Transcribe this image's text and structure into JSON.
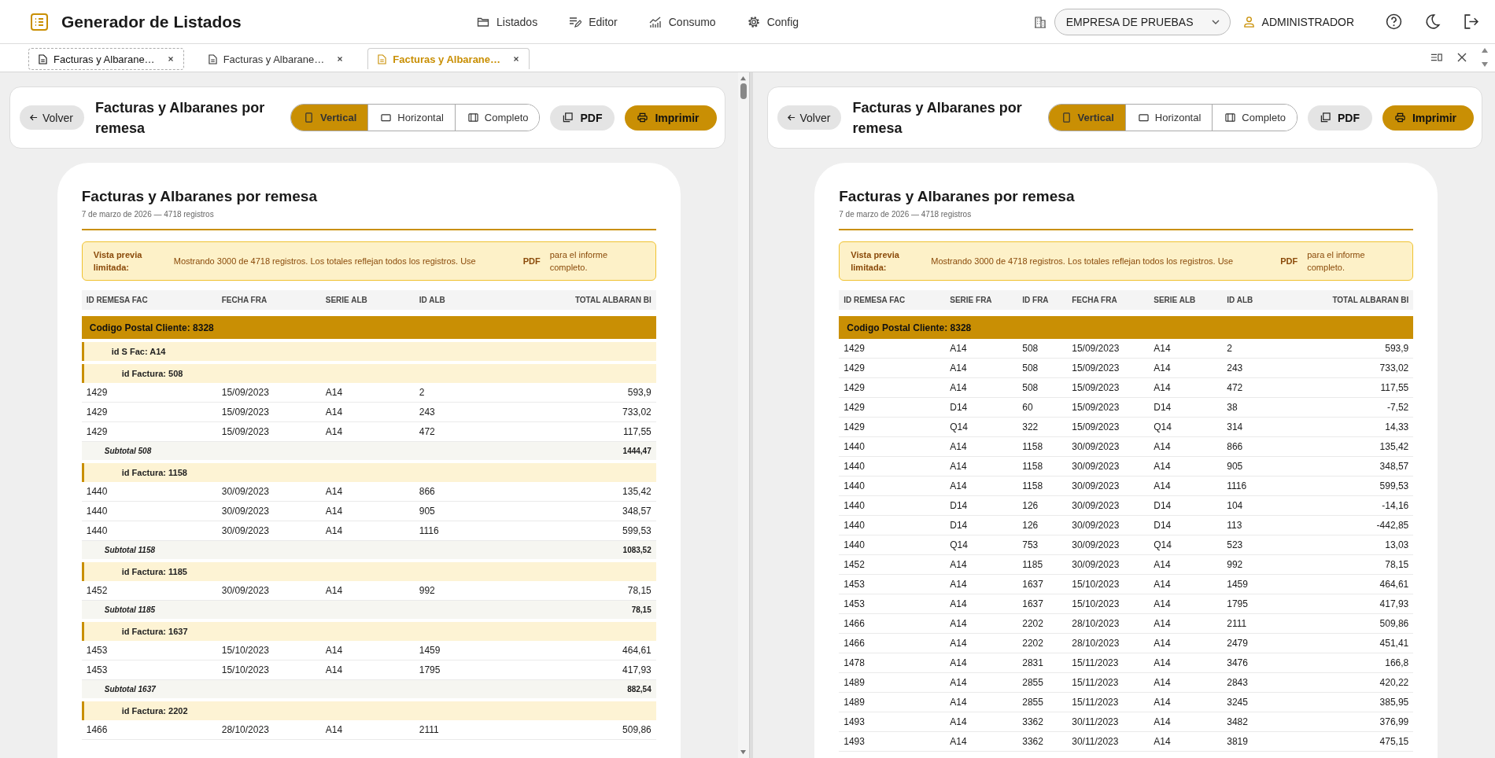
{
  "app": {
    "title": "Generador de Listados"
  },
  "nav": [
    "Listados",
    "Editor",
    "Consumo",
    "Config"
  ],
  "company": {
    "value": "EMPRESA DE PRUEBAS"
  },
  "user": "ADMINISTRADOR",
  "tabs": [
    {
      "label": "Facturas y Albarane…",
      "selected": false,
      "focused": true
    },
    {
      "label": "Facturas y Albarane…",
      "selected": false,
      "focused": false
    },
    {
      "label": "Facturas y Albarane…",
      "selected": true,
      "focused": false
    }
  ],
  "panes": [
    {
      "toolbar": {
        "back": "Volver",
        "title": "Facturas y Albaranes por remesa",
        "views": [
          {
            "label": "Vertical",
            "selected": true
          },
          {
            "label": "Horizontal",
            "selected": false
          },
          {
            "label": "Completo",
            "selected": false
          }
        ],
        "pdf": "PDF",
        "print": "Imprimir"
      },
      "report": {
        "title": "Facturas y Albaranes por remesa",
        "subtitle": "7 de marzo de 2026 — 4718 registros",
        "notice": {
          "label": "Vista previa limitada:",
          "text": "Mostrando 3000 de 4718 registros. Los totales reflejan todos los registros. Use",
          "link": "PDF",
          "after": "para el informe completo."
        },
        "columns": [
          "ID REMESA FAC",
          "FECHA FRA",
          "SERIE ALB",
          "ID ALB",
          "TOTAL ALBARAN BI"
        ],
        "groups": [
          {
            "label": "Codigo Postal Cliente: 8328",
            "children": [
              {
                "label": "id S Fac: A14",
                "children": [
                  {
                    "label": "id Factura: 508",
                    "rows": [
                      [
                        "1429",
                        "15/09/2023",
                        "A14",
                        "2",
                        "593,9"
                      ],
                      [
                        "1429",
                        "15/09/2023",
                        "A14",
                        "243",
                        "733,02"
                      ],
                      [
                        "1429",
                        "15/09/2023",
                        "A14",
                        "472",
                        "117,55"
                      ]
                    ],
                    "subtotal": {
                      "label": "Subtotal 508",
                      "value": "1444,47"
                    }
                  },
                  {
                    "label": "id Factura: 1158",
                    "rows": [
                      [
                        "1440",
                        "30/09/2023",
                        "A14",
                        "866",
                        "135,42"
                      ],
                      [
                        "1440",
                        "30/09/2023",
                        "A14",
                        "905",
                        "348,57"
                      ],
                      [
                        "1440",
                        "30/09/2023",
                        "A14",
                        "1116",
                        "599,53"
                      ]
                    ],
                    "subtotal": {
                      "label": "Subtotal 1158",
                      "value": "1083,52"
                    }
                  },
                  {
                    "label": "id Factura: 1185",
                    "rows": [
                      [
                        "1452",
                        "30/09/2023",
                        "A14",
                        "992",
                        "78,15"
                      ]
                    ],
                    "subtotal": {
                      "label": "Subtotal 1185",
                      "value": "78,15"
                    }
                  },
                  {
                    "label": "id Factura: 1637",
                    "rows": [
                      [
                        "1453",
                        "15/10/2023",
                        "A14",
                        "1459",
                        "464,61"
                      ],
                      [
                        "1453",
                        "15/10/2023",
                        "A14",
                        "1795",
                        "417,93"
                      ]
                    ],
                    "subtotal": {
                      "label": "Subtotal 1637",
                      "value": "882,54"
                    }
                  },
                  {
                    "label": "id Factura: 2202",
                    "rows": [
                      [
                        "1466",
                        "28/10/2023",
                        "A14",
                        "2111",
                        "509,86"
                      ]
                    ]
                  }
                ]
              }
            ]
          }
        ]
      }
    },
    {
      "toolbar": {
        "back": "Volver",
        "title": "Facturas y Albaranes por remesa",
        "views": [
          {
            "label": "Vertical",
            "selected": true
          },
          {
            "label": "Horizontal",
            "selected": false
          },
          {
            "label": "Completo",
            "selected": false
          }
        ],
        "pdf": "PDF",
        "print": "Imprimir"
      },
      "report": {
        "title": "Facturas y Albaranes por remesa",
        "subtitle": "7 de marzo de 2026 — 4718 registros",
        "notice": {
          "label": "Vista previa limitada:",
          "text": "Mostrando 3000 de 4718 registros. Los totales reflejan todos los registros. Use",
          "link": "PDF",
          "after": "para el informe completo."
        },
        "columns": [
          "ID REMESA FAC",
          "SERIE FRA",
          "ID FRA",
          "FECHA FRA",
          "SERIE ALB",
          "ID ALB",
          "TOTAL ALBARAN BI"
        ],
        "groups": [
          {
            "label": "Codigo Postal Cliente: 8328",
            "rows": [
              [
                "1429",
                "A14",
                "508",
                "15/09/2023",
                "A14",
                "2",
                "593,9"
              ],
              [
                "1429",
                "A14",
                "508",
                "15/09/2023",
                "A14",
                "243",
                "733,02"
              ],
              [
                "1429",
                "A14",
                "508",
                "15/09/2023",
                "A14",
                "472",
                "117,55"
              ],
              [
                "1429",
                "D14",
                "60",
                "15/09/2023",
                "D14",
                "38",
                "-7,52"
              ],
              [
                "1429",
                "Q14",
                "322",
                "15/09/2023",
                "Q14",
                "314",
                "14,33"
              ],
              [
                "1440",
                "A14",
                "1158",
                "30/09/2023",
                "A14",
                "866",
                "135,42"
              ],
              [
                "1440",
                "A14",
                "1158",
                "30/09/2023",
                "A14",
                "905",
                "348,57"
              ],
              [
                "1440",
                "A14",
                "1158",
                "30/09/2023",
                "A14",
                "1116",
                "599,53"
              ],
              [
                "1440",
                "D14",
                "126",
                "30/09/2023",
                "D14",
                "104",
                "-14,16"
              ],
              [
                "1440",
                "D14",
                "126",
                "30/09/2023",
                "D14",
                "113",
                "-442,85"
              ],
              [
                "1440",
                "Q14",
                "753",
                "30/09/2023",
                "Q14",
                "523",
                "13,03"
              ],
              [
                "1452",
                "A14",
                "1185",
                "30/09/2023",
                "A14",
                "992",
                "78,15"
              ],
              [
                "1453",
                "A14",
                "1637",
                "15/10/2023",
                "A14",
                "1459",
                "464,61"
              ],
              [
                "1453",
                "A14",
                "1637",
                "15/10/2023",
                "A14",
                "1795",
                "417,93"
              ],
              [
                "1466",
                "A14",
                "2202",
                "28/10/2023",
                "A14",
                "2111",
                "509,86"
              ],
              [
                "1466",
                "A14",
                "2202",
                "28/10/2023",
                "A14",
                "2479",
                "451,41"
              ],
              [
                "1478",
                "A14",
                "2831",
                "15/11/2023",
                "A14",
                "3476",
                "166,8"
              ],
              [
                "1489",
                "A14",
                "2855",
                "15/11/2023",
                "A14",
                "2843",
                "420,22"
              ],
              [
                "1489",
                "A14",
                "2855",
                "15/11/2023",
                "A14",
                "3245",
                "385,95"
              ],
              [
                "1493",
                "A14",
                "3362",
                "30/11/2023",
                "A14",
                "3482",
                "376,99"
              ],
              [
                "1493",
                "A14",
                "3362",
                "30/11/2023",
                "A14",
                "3819",
                "475,15"
              ]
            ]
          }
        ]
      }
    }
  ]
}
